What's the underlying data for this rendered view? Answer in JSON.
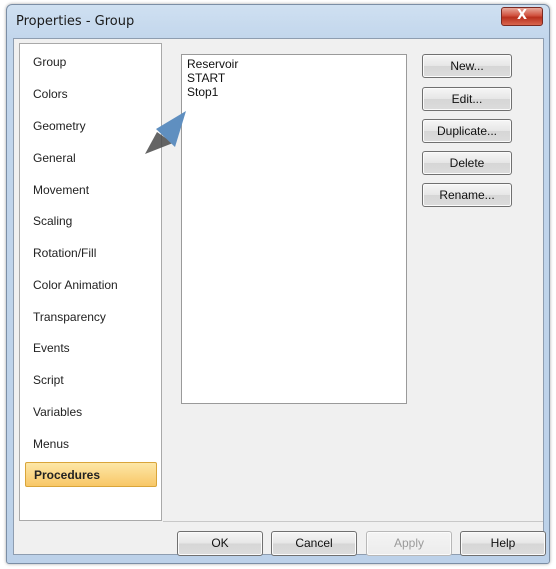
{
  "window": {
    "title": "Properties - Group",
    "close_label": "X"
  },
  "nav": {
    "items": [
      {
        "label": "Group"
      },
      {
        "label": "Colors"
      },
      {
        "label": "Geometry"
      },
      {
        "label": "General"
      },
      {
        "label": "Movement"
      },
      {
        "label": "Scaling"
      },
      {
        "label": "Rotation/Fill"
      },
      {
        "label": "Color Animation"
      },
      {
        "label": "Transparency"
      },
      {
        "label": "Events"
      },
      {
        "label": "Script"
      },
      {
        "label": "Variables"
      },
      {
        "label": "Menus"
      },
      {
        "label": "Procedures",
        "selected": true
      }
    ]
  },
  "procedures": {
    "items": [
      "Reservoir",
      "START",
      "Stop1"
    ],
    "new_label": "New...",
    "edit_label": "Edit...",
    "duplicate_label": "Duplicate...",
    "delete_label": "Delete",
    "rename_label": "Rename..."
  },
  "footer": {
    "ok_label": "OK",
    "cancel_label": "Cancel",
    "apply_label": "Apply",
    "help_label": "Help"
  },
  "colors": {
    "selected_item_bg": "#f8c767",
    "pointer_arrow": "#5f8fc0"
  },
  "icons": {
    "pointer": "arrow-pointer-icon",
    "close": "close-icon"
  }
}
